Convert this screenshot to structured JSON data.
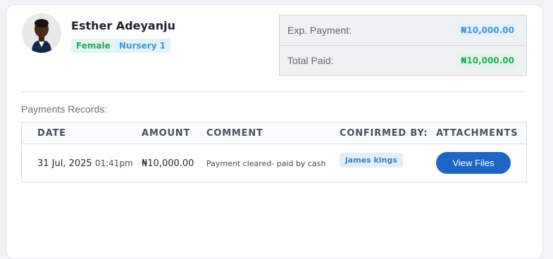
{
  "student": {
    "name": "Esther Adeyanju",
    "gender": "Female",
    "class": "Nursery 1"
  },
  "summary": {
    "expected_label": "Exp. Payment:",
    "expected_amount": "₦10,000.00",
    "paid_label": "Total Paid:",
    "paid_amount": "₦10,000.00"
  },
  "records": {
    "title": "Payments Records:",
    "columns": [
      "DATE",
      "AMOUNT",
      "COMMENT",
      "CONFIRMED BY:",
      "ATTACHMENTS"
    ],
    "rows": [
      {
        "date": "31 Jul, 2025",
        "time": "01:41pm",
        "amount": "₦10,000.00",
        "comment": "Payment cleared- paid by cash",
        "confirmed_by": "james kings",
        "attachment_button": "View Files"
      }
    ]
  },
  "colors": {
    "primary_button": "#1f65c3",
    "gender_badge": "#2aa36b",
    "class_badge": "#3f97d4",
    "paid_amount": "#27a95b",
    "expected_amount": "#3f97d4"
  },
  "icons": {
    "avatar": "student-photo"
  }
}
